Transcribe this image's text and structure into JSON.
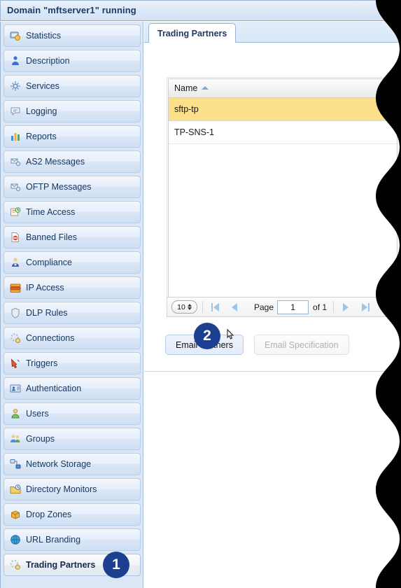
{
  "window": {
    "title": "Domain \"mftserver1\" running"
  },
  "sidebar": {
    "items": [
      {
        "label": "Statistics",
        "icon": "statistics-icon",
        "selected": false
      },
      {
        "label": "Description",
        "icon": "description-icon",
        "selected": false
      },
      {
        "label": "Services",
        "icon": "services-icon",
        "selected": false
      },
      {
        "label": "Logging",
        "icon": "logging-icon",
        "selected": false
      },
      {
        "label": "Reports",
        "icon": "reports-icon",
        "selected": false
      },
      {
        "label": "AS2 Messages",
        "icon": "as2-messages-icon",
        "selected": false
      },
      {
        "label": "OFTP Messages",
        "icon": "oftp-messages-icon",
        "selected": false
      },
      {
        "label": "Time Access",
        "icon": "time-access-icon",
        "selected": false
      },
      {
        "label": "Banned Files",
        "icon": "banned-files-icon",
        "selected": false
      },
      {
        "label": "Compliance",
        "icon": "compliance-icon",
        "selected": false
      },
      {
        "label": "IP Access",
        "icon": "ip-access-icon",
        "selected": false
      },
      {
        "label": "DLP Rules",
        "icon": "dlp-rules-icon",
        "selected": false
      },
      {
        "label": "Connections",
        "icon": "connections-icon",
        "selected": false
      },
      {
        "label": "Triggers",
        "icon": "triggers-icon",
        "selected": false
      },
      {
        "label": "Authentication",
        "icon": "authentication-icon",
        "selected": false
      },
      {
        "label": "Users",
        "icon": "users-icon",
        "selected": false
      },
      {
        "label": "Groups",
        "icon": "groups-icon",
        "selected": false
      },
      {
        "label": "Network Storage",
        "icon": "network-storage-icon",
        "selected": false
      },
      {
        "label": "Directory Monitors",
        "icon": "directory-monitors-icon",
        "selected": false
      },
      {
        "label": "Drop Zones",
        "icon": "drop-zones-icon",
        "selected": false
      },
      {
        "label": "URL Branding",
        "icon": "url-branding-icon",
        "selected": false
      },
      {
        "label": "Trading Partners",
        "icon": "trading-partners-icon",
        "selected": true
      }
    ]
  },
  "tabs": [
    {
      "label": "Trading Partners",
      "active": true
    }
  ],
  "grid": {
    "columns": [
      "Name"
    ],
    "sort": {
      "column": "Name",
      "direction": "asc"
    },
    "rows": [
      {
        "name": "sftp-tp",
        "selected": true
      },
      {
        "name": "TP-SNS-1",
        "selected": false
      }
    ]
  },
  "pager": {
    "page_size": "10",
    "page_label": "Page",
    "page_value": "1",
    "of_label": "of 1",
    "first_title": "First Page",
    "prev_title": "Previous Page",
    "next_title": "Next Page",
    "last_title": "Last Page"
  },
  "buttons": {
    "email_partners": "Email Partners",
    "email_specification": "Email Specification"
  },
  "annotations": {
    "badges": [
      {
        "number": "1",
        "target": "sidebar-item-trading-partners"
      },
      {
        "number": "2",
        "target": "email-partners-button"
      }
    ]
  },
  "colors": {
    "badge": "#1c3f8f",
    "row_selected": "#fbdf8a",
    "title_text": "#1c3a66",
    "sidebar_bg": "#dbe7f6"
  }
}
